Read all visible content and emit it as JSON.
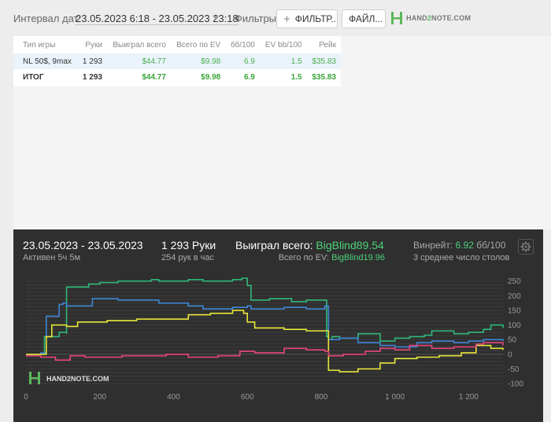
{
  "toolbar": {
    "interval_label": "Интервал дат:",
    "interval_value": "23.05.2023 6:18 - 23.05.2023 23:18",
    "filters_label": "Фильтры:",
    "filter_button": "ФИЛЬТР...",
    "files_button": "ФАЙЛ...",
    "logo_text_a": "HAND",
    "logo_text_b": "2",
    "logo_text_c": "NOTE.COM"
  },
  "stats_table": {
    "columns": [
      "Тип игры",
      "Руки",
      "Выиграл всего",
      "Всего по EV",
      "бб/100",
      "EV bb/100",
      "Рейк"
    ],
    "rows": [
      [
        "NL 50$, 9max",
        "1 293",
        "$44.77",
        "$9.98",
        "6.9",
        "1.5",
        "$35.83"
      ]
    ],
    "total": [
      "ИТОГ",
      "1 293",
      "$44.77",
      "$9.98",
      "6.9",
      "1.5",
      "$35.83"
    ]
  },
  "graph_header": {
    "date_range": "23.05.2023 - 23.05.2023",
    "active": "Активен 5ч 5м",
    "hands": "1 293 Руки",
    "hands_per_hour": "254 рук в час",
    "won_label": "Выиграл всего:",
    "won_value": "BigBlind89.54",
    "ev_label": "Всего по EV:",
    "ev_value": "BigBlind19.96",
    "winrate_label": "Винрейт:",
    "winrate_value": "6.92",
    "winrate_unit": "бб/100",
    "avg_tables": "3 среднее число столов",
    "watermark": "HAND2NOTE.COM"
  },
  "chart_data": {
    "type": "line",
    "xlim": [
      0,
      1293
    ],
    "ylim": [
      -100,
      260
    ],
    "x_ticks": [
      "0",
      "200",
      "400",
      "600",
      "800",
      "1 000",
      "1 200"
    ],
    "y_ticks": [
      "250",
      "200",
      "150",
      "100",
      "50",
      "0",
      "-50",
      "-100"
    ],
    "grid": true,
    "colors": {
      "green": "#2fb879",
      "blue": "#3f86d6",
      "yellow": "#e6e63a",
      "pink": "#e8457d"
    },
    "series": [
      {
        "color": "green",
        "x": [
          0,
          40,
          50,
          90,
          110,
          110,
          170,
          200,
          250,
          340,
          360,
          440,
          480,
          560,
          585,
          600,
          610,
          660,
          720,
          760,
          810,
          815,
          820,
          830,
          850,
          900,
          960,
          1000,
          1040,
          1080,
          1100,
          1160,
          1200,
          1240,
          1260,
          1293
        ],
        "y": [
          0,
          0,
          60,
          75,
          70,
          230,
          240,
          245,
          250,
          255,
          250,
          255,
          250,
          255,
          260,
          235,
          185,
          190,
          180,
          185,
          185,
          60,
          50,
          60,
          55,
          70,
          45,
          55,
          60,
          65,
          80,
          70,
          75,
          85,
          100,
          90
        ]
      },
      {
        "color": "blue",
        "x": [
          0,
          40,
          55,
          90,
          100,
          110,
          180,
          250,
          360,
          440,
          480,
          560,
          600,
          610,
          700,
          760,
          810,
          820,
          850,
          900,
          960,
          1000,
          1060,
          1100,
          1160,
          1200,
          1240,
          1293
        ],
        "y": [
          0,
          5,
          130,
          170,
          175,
          165,
          190,
          185,
          175,
          165,
          155,
          160,
          165,
          155,
          160,
          155,
          165,
          50,
          55,
          40,
          30,
          25,
          40,
          45,
          40,
          45,
          50,
          45
        ]
      },
      {
        "color": "yellow",
        "x": [
          0,
          40,
          55,
          70,
          110,
          140,
          220,
          300,
          440,
          500,
          560,
          590,
          600,
          620,
          700,
          760,
          810,
          820,
          850,
          900,
          960,
          1000,
          1060,
          1120,
          1180,
          1220,
          1260,
          1293
        ],
        "y": [
          0,
          0,
          60,
          100,
          95,
          110,
          115,
          120,
          135,
          140,
          150,
          140,
          110,
          90,
          85,
          80,
          80,
          -55,
          -60,
          -50,
          -30,
          -15,
          -10,
          -5,
          5,
          30,
          20,
          15
        ]
      },
      {
        "color": "pink",
        "x": [
          0,
          40,
          80,
          120,
          160,
          260,
          380,
          440,
          520,
          580,
          620,
          700,
          760,
          810,
          820,
          860,
          920,
          960,
          1000,
          1040,
          1100,
          1160,
          1220,
          1240,
          1293
        ],
        "y": [
          -5,
          -10,
          -20,
          -5,
          -10,
          -5,
          0,
          -10,
          -5,
          10,
          5,
          20,
          15,
          10,
          -5,
          0,
          10,
          20,
          15,
          30,
          20,
          25,
          35,
          40,
          30
        ]
      }
    ]
  }
}
